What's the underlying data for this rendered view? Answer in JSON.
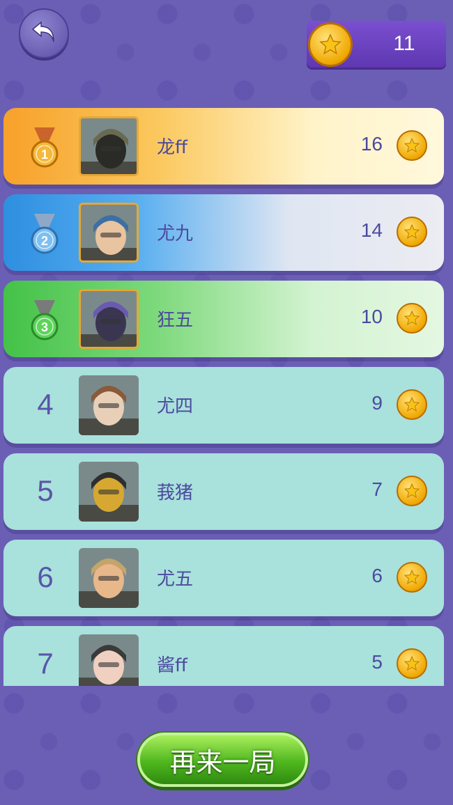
{
  "header": {
    "back_icon": "back-arrow-icon",
    "coin_icon": "gold-coin-icon",
    "coin_count": "11"
  },
  "leaderboard": [
    {
      "rank": "1",
      "medal": "gold",
      "name": "龙ff",
      "score": "16",
      "bg": "linear-gradient(90deg,#f7a12a 0%,#fbc85e 35%,#fff3c8 70%,#fff8dc 100%)"
    },
    {
      "rank": "2",
      "medal": "silver",
      "name": "尤九",
      "score": "14",
      "bg": "linear-gradient(90deg,#2e8fe0 0%,#57aef0 30%,#dfe6f2 65%,#ececf2 100%)"
    },
    {
      "rank": "3",
      "medal": "bronze-green",
      "name": "狂五",
      "score": "10",
      "bg": "linear-gradient(90deg,#44c248 0%,#7ed97c 35%,#d3f3d1 70%,#e4f7e2 100%)"
    },
    {
      "rank": "4",
      "medal": "",
      "name": "尤四",
      "score": "9",
      "bg": "#a9e1dc"
    },
    {
      "rank": "5",
      "medal": "",
      "name": "莪猪",
      "score": "7",
      "bg": "#a9e1dc"
    },
    {
      "rank": "6",
      "medal": "",
      "name": "尤五",
      "score": "6",
      "bg": "#a9e1dc"
    },
    {
      "rank": "7",
      "medal": "",
      "name": "酱ff",
      "score": "5",
      "bg": "#a9e1dc"
    }
  ],
  "play_again_label": "再来一局"
}
